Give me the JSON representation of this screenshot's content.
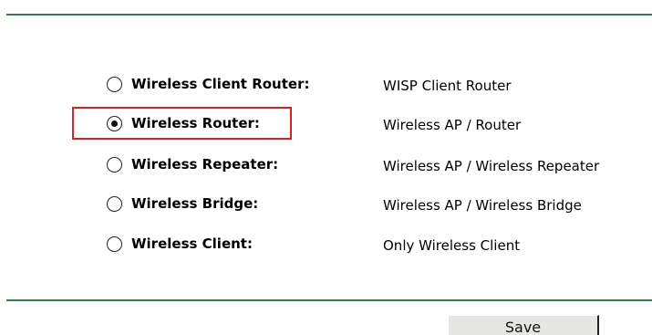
{
  "modes": [
    {
      "label": "Wireless Client Router:",
      "description": "WISP Client Router",
      "selected": false
    },
    {
      "label": "Wireless Router:",
      "description": "Wireless AP / Router",
      "selected": true
    },
    {
      "label": "Wireless Repeater:",
      "description": "Wireless AP / Wireless Repeater",
      "selected": false
    },
    {
      "label": "Wireless Bridge:",
      "description": "Wireless AP / Wireless Bridge",
      "selected": false
    },
    {
      "label": "Wireless Client:",
      "description": "Only Wireless Client",
      "selected": false
    }
  ],
  "buttons": {
    "save_label": "Save"
  },
  "colors": {
    "divider": "#3a7a4a",
    "highlight": "#d92020",
    "button_bg": "#e6e6e4"
  },
  "icons": {
    "radio_unselected": "radio-empty-icon",
    "radio_selected": "radio-filled-icon"
  }
}
